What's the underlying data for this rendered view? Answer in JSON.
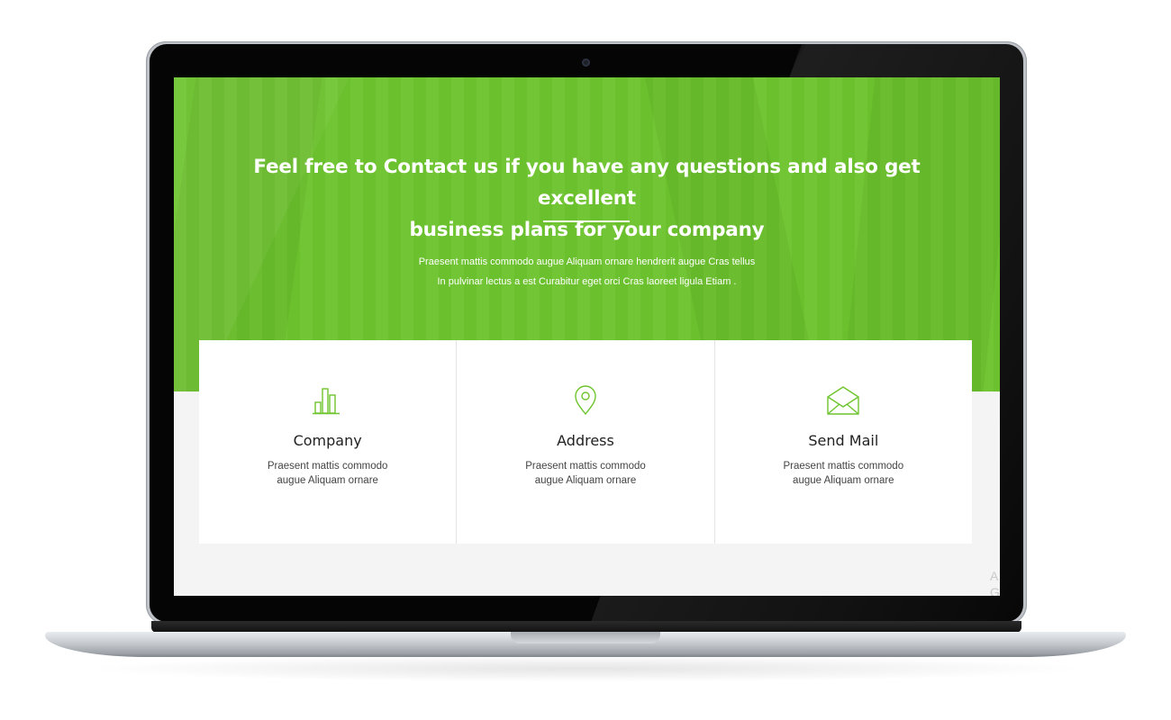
{
  "hero": {
    "title_line1": "Feel free to Contact us if you have any questions and also get excellent",
    "title_line2": "business plans for your company",
    "text_line1": "Praesent mattis commodo augue Aliquam ornare hendrerit augue Cras tellus",
    "text_line2": "In pulvinar lectus a est Curabitur eget orci Cras laoreet ligula Etiam ."
  },
  "cards": [
    {
      "icon": "bar-chart-icon",
      "title": "Company",
      "text_line1": "Praesent mattis commodo",
      "text_line2": "augue Aliquam ornare"
    },
    {
      "icon": "map-pin-icon",
      "title": "Address",
      "text_line1": "Praesent mattis commodo",
      "text_line2": "augue Aliquam ornare"
    },
    {
      "icon": "envelope-icon",
      "title": "Send Mail",
      "text_line1": "Praesent mattis commodo",
      "text_line2": "augue Aliquam ornare"
    }
  ],
  "corner_text": "A G",
  "colors": {
    "accent_green": "#6ec42e",
    "icon_green": "#6ec42e",
    "card_bg": "#ffffff",
    "page_bg": "#f4f4f4"
  }
}
